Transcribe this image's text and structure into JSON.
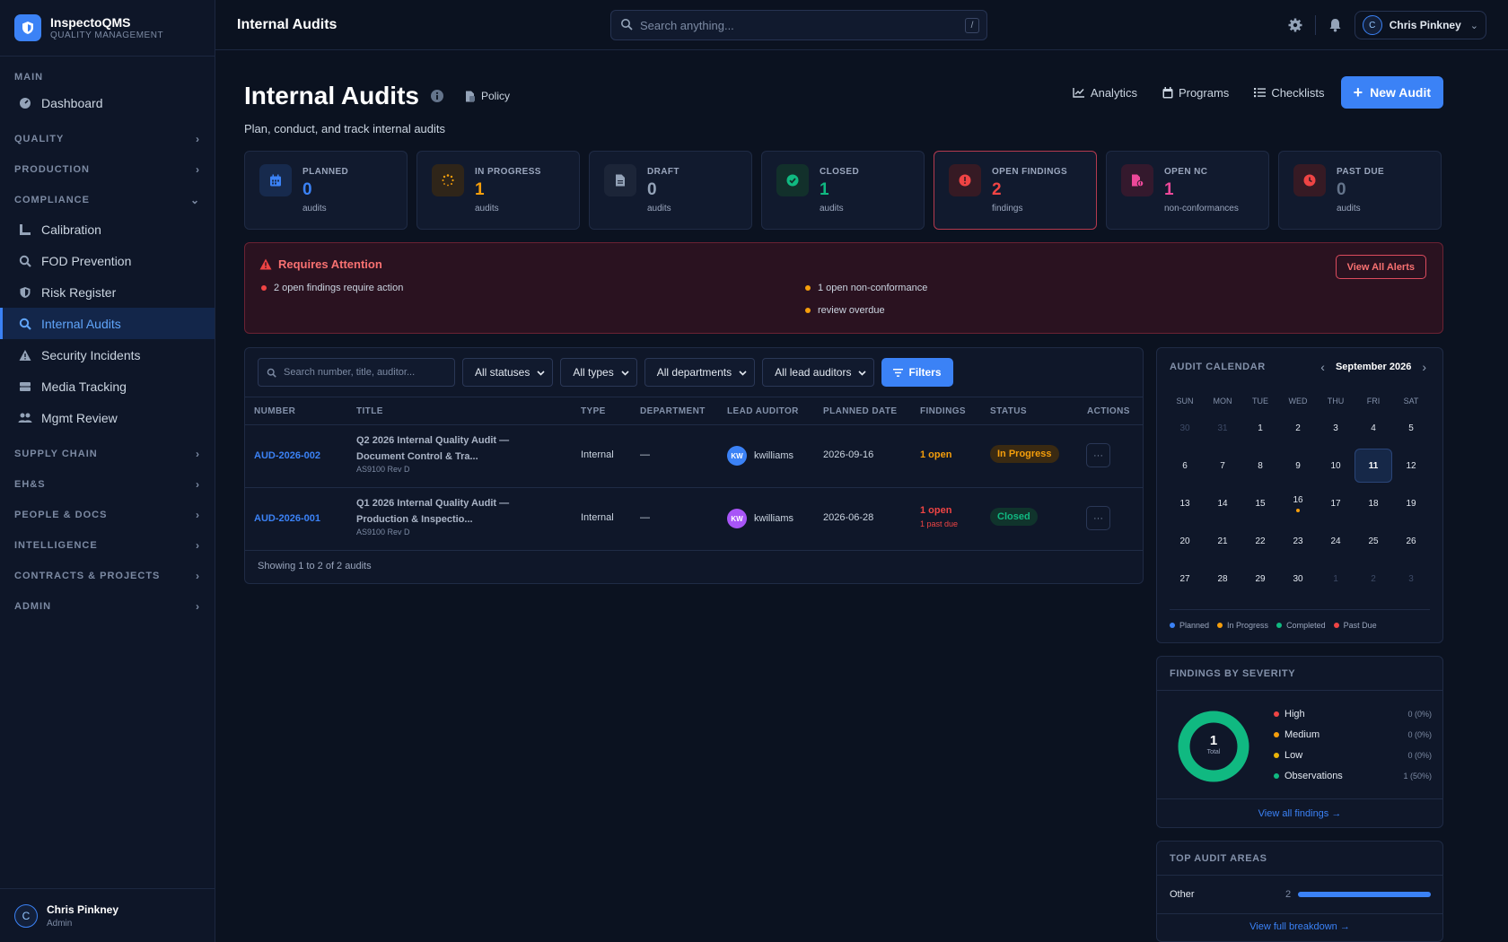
{
  "brand": {
    "name": "InspectoQMS",
    "sub": "QUALITY MANAGEMENT"
  },
  "nav": {
    "main_label": "MAIN",
    "dashboard": "Dashboard",
    "quality": "QUALITY",
    "production": "PRODUCTION",
    "compliance": "COMPLIANCE",
    "items": [
      {
        "label": "Calibration",
        "icon": "ruler-icon"
      },
      {
        "label": "FOD Prevention",
        "icon": "magnify-icon"
      },
      {
        "label": "Risk Register",
        "icon": "shield-icon"
      },
      {
        "label": "Internal Audits",
        "icon": "search-icon"
      },
      {
        "label": "Security Incidents",
        "icon": "warning-icon"
      },
      {
        "label": "Media Tracking",
        "icon": "drive-icon"
      },
      {
        "label": "Mgmt Review",
        "icon": "users-icon"
      }
    ],
    "supply_chain": "SUPPLY CHAIN",
    "ehs": "EH&S",
    "people_docs": "PEOPLE & DOCS",
    "intelligence": "INTELLIGENCE",
    "contracts": "CONTRACTS & PROJECTS",
    "admin": "ADMIN"
  },
  "sidebar_user": {
    "initial": "C",
    "name": "Chris Pinkney",
    "role": "Admin"
  },
  "topbar": {
    "title": "Internal Audits",
    "search_placeholder": "Search anything...",
    "kbd": "/",
    "user_initial": "C",
    "user_name": "Chris Pinkney"
  },
  "page": {
    "title": "Internal Audits",
    "policy": "Policy",
    "subtitle": "Plan, conduct, and track internal audits",
    "analytics": "Analytics",
    "programs": "Programs",
    "checklists": "Checklists",
    "new_audit": "New Audit"
  },
  "stats": [
    {
      "label": "PLANNED",
      "value": "0",
      "unit": "audits",
      "color": "#3b82f6",
      "bg": "#172a4d"
    },
    {
      "label": "IN PROGRESS",
      "value": "1",
      "unit": "audits",
      "color": "#f59e0b",
      "bg": "#2f2519"
    },
    {
      "label": "DRAFT",
      "value": "0",
      "unit": "audits",
      "color": "#94a3b8",
      "bg": "#1c2538"
    },
    {
      "label": "CLOSED",
      "value": "1",
      "unit": "audits",
      "color": "#10b981",
      "bg": "#12302b"
    },
    {
      "label": "OPEN FINDINGS",
      "value": "2",
      "unit": "findings",
      "color": "#ef4444",
      "bg": "#361a24"
    },
    {
      "label": "OPEN NC",
      "value": "1",
      "unit": "non-conformances",
      "color": "#ec4899",
      "bg": "#34192d"
    },
    {
      "label": "PAST DUE",
      "value": "0",
      "unit": "audits",
      "color": "#ef4444",
      "bg": "#361a24"
    }
  ],
  "attention": {
    "title": "Requires Attention",
    "item1": "2 open findings require action",
    "item2": "1 open non-conformance",
    "item3": "review overdue",
    "button": "View All Alerts"
  },
  "filters": {
    "search_placeholder": "Search number, title, auditor...",
    "statuses": "All statuses",
    "types": "All types",
    "departments": "All departments",
    "lead_auditors": "All lead auditors",
    "button": "Filters"
  },
  "table": {
    "headers": [
      "NUMBER",
      "TITLE",
      "TYPE",
      "DEPARTMENT",
      "LEAD AUDITOR",
      "PLANNED DATE",
      "FINDINGS",
      "STATUS",
      "ACTIONS"
    ],
    "rows": [
      {
        "number": "AUD-2026-002",
        "title1": "Q2 2026 Internal Quality Audit —",
        "title2": "Document Control & Tra...",
        "std": "AS9100 Rev D",
        "type": "Internal",
        "dept": "—",
        "initials": "KW",
        "auditor": "kwilliams",
        "avatar": "#3b82f6",
        "date": "2026-09-16",
        "findings": "1 open",
        "findings_sub": "",
        "status": "In Progress",
        "actions": "···"
      },
      {
        "number": "AUD-2026-001",
        "title1": "Q1 2026 Internal Quality Audit —",
        "title2": "Production & Inspectio...",
        "std": "AS9100 Rev D",
        "type": "Internal",
        "dept": "—",
        "initials": "KW",
        "auditor": "kwilliams",
        "avatar": "#a855f7",
        "date": "2026-06-28",
        "findings": "1 open",
        "findings_sub": "1 past due",
        "status": "Closed",
        "actions": "···"
      }
    ],
    "footer": "Showing 1 to 2 of 2 audits"
  },
  "calendar": {
    "title": "AUDIT CALENDAR",
    "month": "September 2026",
    "prev": "‹",
    "next": "›",
    "dow": [
      "SUN",
      "MON",
      "TUE",
      "WED",
      "THU",
      "FRI",
      "SAT"
    ],
    "weeks": [
      [
        "30",
        "31",
        "1",
        "2",
        "3",
        "4",
        "5"
      ],
      [
        "6",
        "7",
        "8",
        "9",
        "10",
        "11",
        "12"
      ],
      [
        "13",
        "14",
        "15",
        "16",
        "17",
        "18",
        "19"
      ],
      [
        "20",
        "21",
        "22",
        "23",
        "24",
        "25",
        "26"
      ],
      [
        "27",
        "28",
        "29",
        "30",
        "1",
        "2",
        "3"
      ]
    ],
    "legend": [
      "Planned",
      "In Progress",
      "Completed",
      "Past Due"
    ]
  },
  "severity": {
    "title": "FINDINGS BY SEVERITY",
    "total": "1",
    "total_label": "Total",
    "observations_fraction": 1.0,
    "rows": [
      {
        "name": "High",
        "pct": "0 (0%)",
        "color": "#ef4444"
      },
      {
        "name": "Medium",
        "pct": "0 (0%)",
        "color": "#f59e0b"
      },
      {
        "name": "Low",
        "pct": "0 (0%)",
        "color": "#eab308"
      },
      {
        "name": "Observations",
        "pct": "1 (50%)",
        "color": "#10b981"
      }
    ],
    "link": "View all findings →"
  },
  "areas": {
    "title": "TOP AUDIT AREAS",
    "name": "Other",
    "count": "2",
    "fraction": 1.0,
    "link": "View full breakdown →"
  }
}
